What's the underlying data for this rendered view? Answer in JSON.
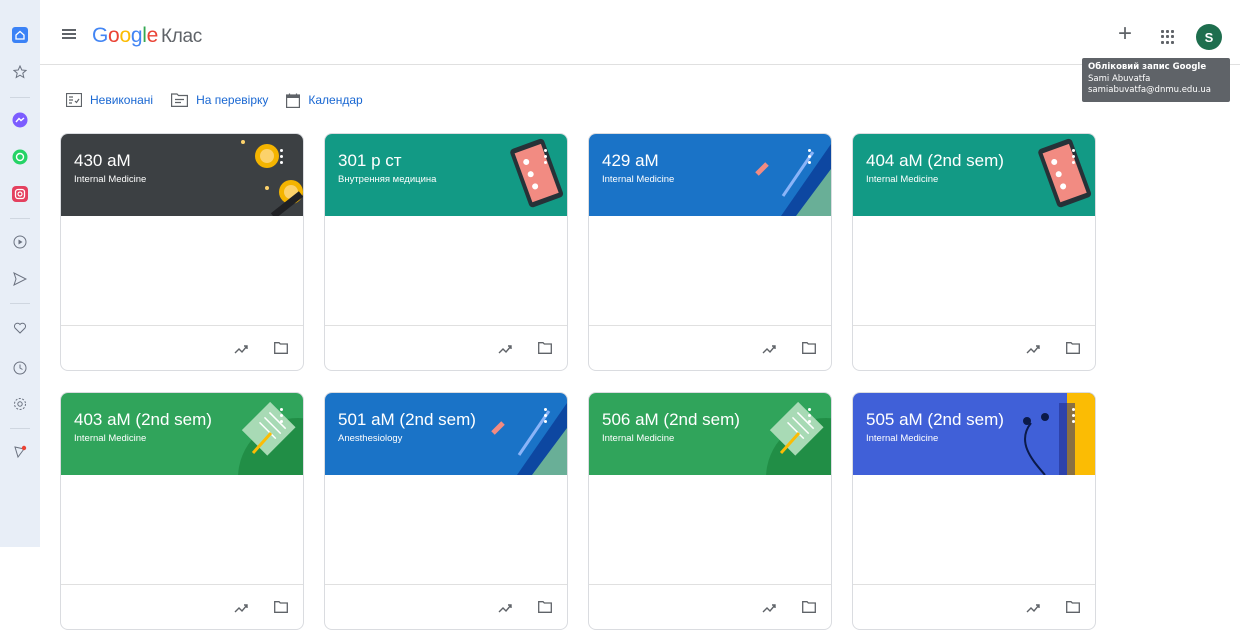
{
  "app": {
    "logo_google": "Google",
    "logo_product": "Клас"
  },
  "sidebar": {
    "items": [
      {
        "icon": "home-icon"
      },
      {
        "icon": "star-icon"
      },
      {
        "icon": "messenger-icon"
      },
      {
        "icon": "whatsapp-icon"
      },
      {
        "icon": "instagram-icon"
      },
      {
        "icon": "play-icon"
      },
      {
        "icon": "send-icon"
      },
      {
        "icon": "heart-icon"
      },
      {
        "icon": "clock-icon"
      },
      {
        "icon": "settings-icon"
      },
      {
        "icon": "bulb-icon"
      }
    ]
  },
  "header": {
    "plus": "+",
    "avatar_letter": "S"
  },
  "tooltip": {
    "title": "Обліковий запис Google",
    "name": "Sami Abuvatfa",
    "email": "samiabuvatfa@dnmu.edu.ua"
  },
  "nav_links": {
    "todo": "Невиконані",
    "review": "На перевірку",
    "calendar": "Календар"
  },
  "colors": {
    "dark": "#3c4043",
    "teal": "#129a85",
    "blue": "#1a73c7",
    "green": "#30a45b",
    "indigo": "#4060d8",
    "tooltip_bg": "#5f6368",
    "link": "#1967d2"
  },
  "classes": [
    {
      "title": "430 aM",
      "subtitle": "Internal Medicine"
    },
    {
      "title": "301 р ст",
      "subtitle": "Внутренняя медицина"
    },
    {
      "title": "429 aM",
      "subtitle": "Internal Medicine"
    },
    {
      "title": "404 aM (2nd sem)",
      "subtitle": "Internal Medicine"
    },
    {
      "title": "403 aM (2nd sem)",
      "subtitle": "Internal Medicine"
    },
    {
      "title": "501 aM (2nd sem)",
      "subtitle": "Anesthesiology"
    },
    {
      "title": "506 aM (2nd sem)",
      "subtitle": "Internal Medicine"
    },
    {
      "title": "505 aM (2nd sem)",
      "subtitle": "Internal Medicine"
    }
  ]
}
